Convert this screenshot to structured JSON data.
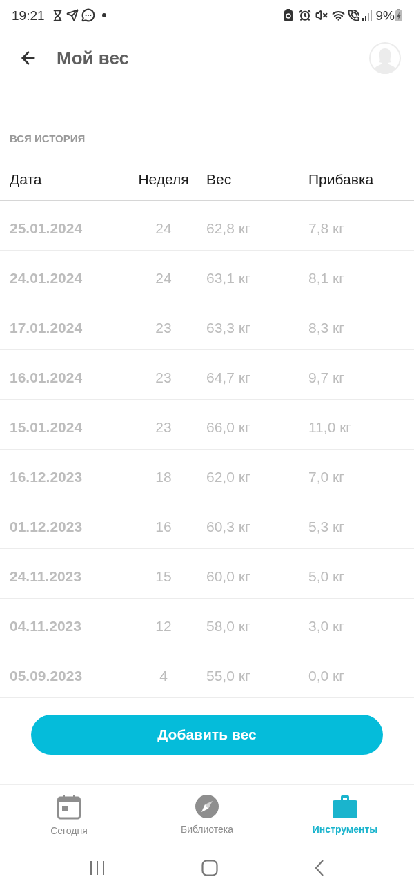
{
  "status_bar": {
    "time": "19:21",
    "battery": "9%"
  },
  "app_bar": {
    "title": "Мой вес"
  },
  "section_title": "ВСЯ ИСТОРИЯ",
  "table": {
    "columns": [
      "Дата",
      "Неделя",
      "Вес",
      "Прибавка"
    ],
    "rows": [
      {
        "date": "25.01.2024",
        "week": "24",
        "weight": "62,8 кг",
        "gain": "7,8 кг"
      },
      {
        "date": "24.01.2024",
        "week": "24",
        "weight": "63,1 кг",
        "gain": "8,1 кг"
      },
      {
        "date": "17.01.2024",
        "week": "23",
        "weight": "63,3 кг",
        "gain": "8,3 кг"
      },
      {
        "date": "16.01.2024",
        "week": "23",
        "weight": "64,7 кг",
        "gain": "9,7 кг"
      },
      {
        "date": "15.01.2024",
        "week": "23",
        "weight": "66,0 кг",
        "gain": "11,0 кг"
      },
      {
        "date": "16.12.2023",
        "week": "18",
        "weight": "62,0 кг",
        "gain": "7,0 кг"
      },
      {
        "date": "01.12.2023",
        "week": "16",
        "weight": "60,3 кг",
        "gain": "5,3 кг"
      },
      {
        "date": "24.11.2023",
        "week": "15",
        "weight": "60,0 кг",
        "gain": "5,0 кг"
      },
      {
        "date": "04.11.2023",
        "week": "12",
        "weight": "58,0 кг",
        "gain": "3,0 кг"
      },
      {
        "date": "05.09.2023",
        "week": "4",
        "weight": "55,0 кг",
        "gain": "0,0 кг"
      }
    ]
  },
  "add_button": "Добавить вес",
  "bottom_nav": [
    {
      "kind": "calendar",
      "label": "Сегодня",
      "selected": false
    },
    {
      "kind": "compass",
      "label": "Библиотека",
      "selected": false
    },
    {
      "kind": "briefcase",
      "label": "Инструменты",
      "selected": true
    }
  ]
}
